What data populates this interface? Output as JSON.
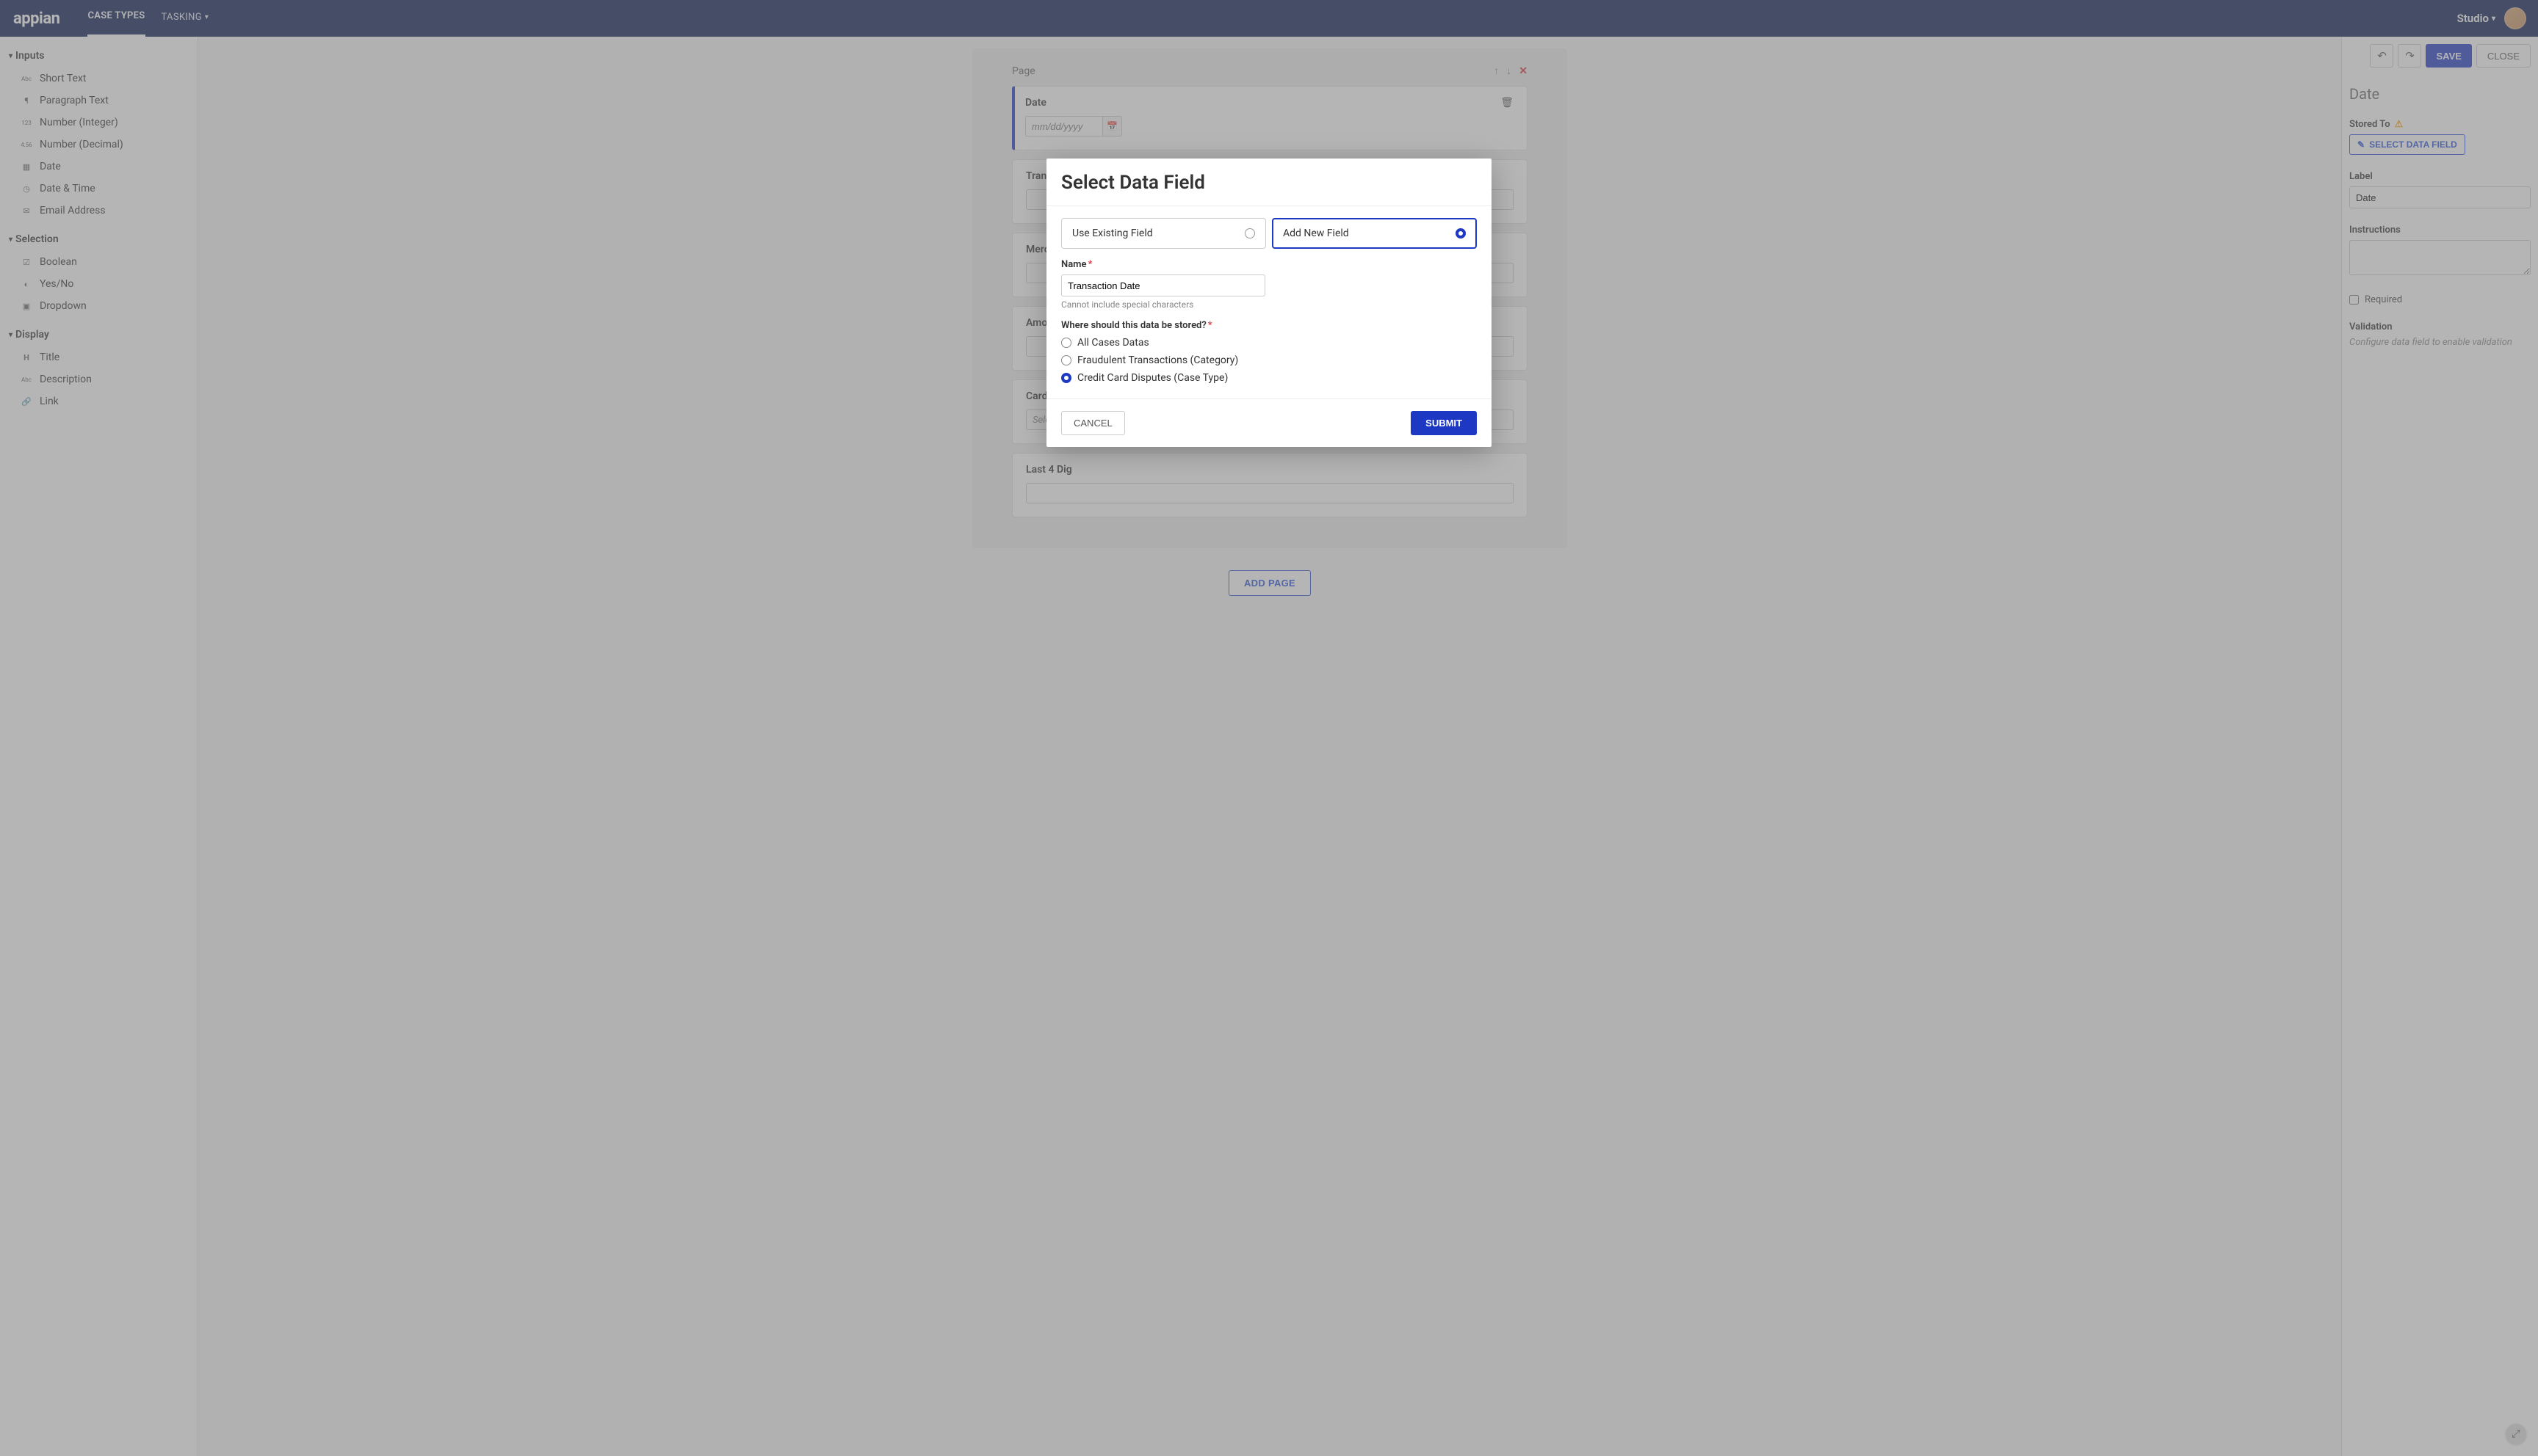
{
  "header": {
    "logo": "appian",
    "tabs": {
      "case_types": "CASE TYPES",
      "tasking": "TASKING"
    },
    "studio": "Studio"
  },
  "sidebar": {
    "sections": {
      "inputs": {
        "title": "Inputs",
        "items": [
          {
            "label": "Short Text",
            "icon": "Abc"
          },
          {
            "label": "Paragraph Text",
            "icon": "¶"
          },
          {
            "label": "Number (Integer)",
            "icon": "123"
          },
          {
            "label": "Number (Decimal)",
            "icon": "4.56"
          },
          {
            "label": "Date",
            "icon": "📅"
          },
          {
            "label": "Date & Time",
            "icon": "🕒"
          },
          {
            "label": "Email Address",
            "icon": "✉"
          }
        ]
      },
      "selection": {
        "title": "Selection",
        "items": [
          {
            "label": "Boolean",
            "icon": "☑"
          },
          {
            "label": "Yes/No",
            "icon": "◐"
          },
          {
            "label": "Dropdown",
            "icon": "▣"
          }
        ]
      },
      "display": {
        "title": "Display",
        "items": [
          {
            "label": "Title",
            "icon": "H"
          },
          {
            "label": "Description",
            "icon": "Abc"
          },
          {
            "label": "Link",
            "icon": "🔗"
          }
        ]
      }
    }
  },
  "canvas": {
    "page_label": "Page",
    "fields": {
      "date": {
        "title": "Date",
        "placeholder": "mm/dd/yyyy"
      },
      "transaction": {
        "title": "Transactio"
      },
      "merchant": {
        "title": "Merchant"
      },
      "amount": {
        "title": "Amount E"
      },
      "card_network": {
        "title": "Card Netw",
        "placeholder": "Select"
      },
      "last4": {
        "title": "Last 4 Dig"
      }
    },
    "add_page": "ADD PAGE"
  },
  "right": {
    "save": "SAVE",
    "close": "CLOSE",
    "title": "Date",
    "stored_to": "Stored To",
    "select_data_field": "SELECT DATA FIELD",
    "label_label": "Label",
    "label_value": "Date",
    "instructions": "Instructions",
    "required": "Required",
    "validation": "Validation",
    "validation_hint": "Configure data field to enable validation"
  },
  "modal": {
    "title": "Select Data Field",
    "use_existing": "Use Existing Field",
    "add_new": "Add New Field",
    "name_label": "Name",
    "name_value": "Transaction Date",
    "name_help": "Cannot include special characters",
    "where_label": "Where should this data be stored?",
    "where_options": {
      "all": "All Cases Datas",
      "fraud": "Fraudulent Transactions (Category)",
      "ccd": "Credit Card Disputes (Case Type)"
    },
    "cancel": "CANCEL",
    "submit": "SUBMIT"
  }
}
